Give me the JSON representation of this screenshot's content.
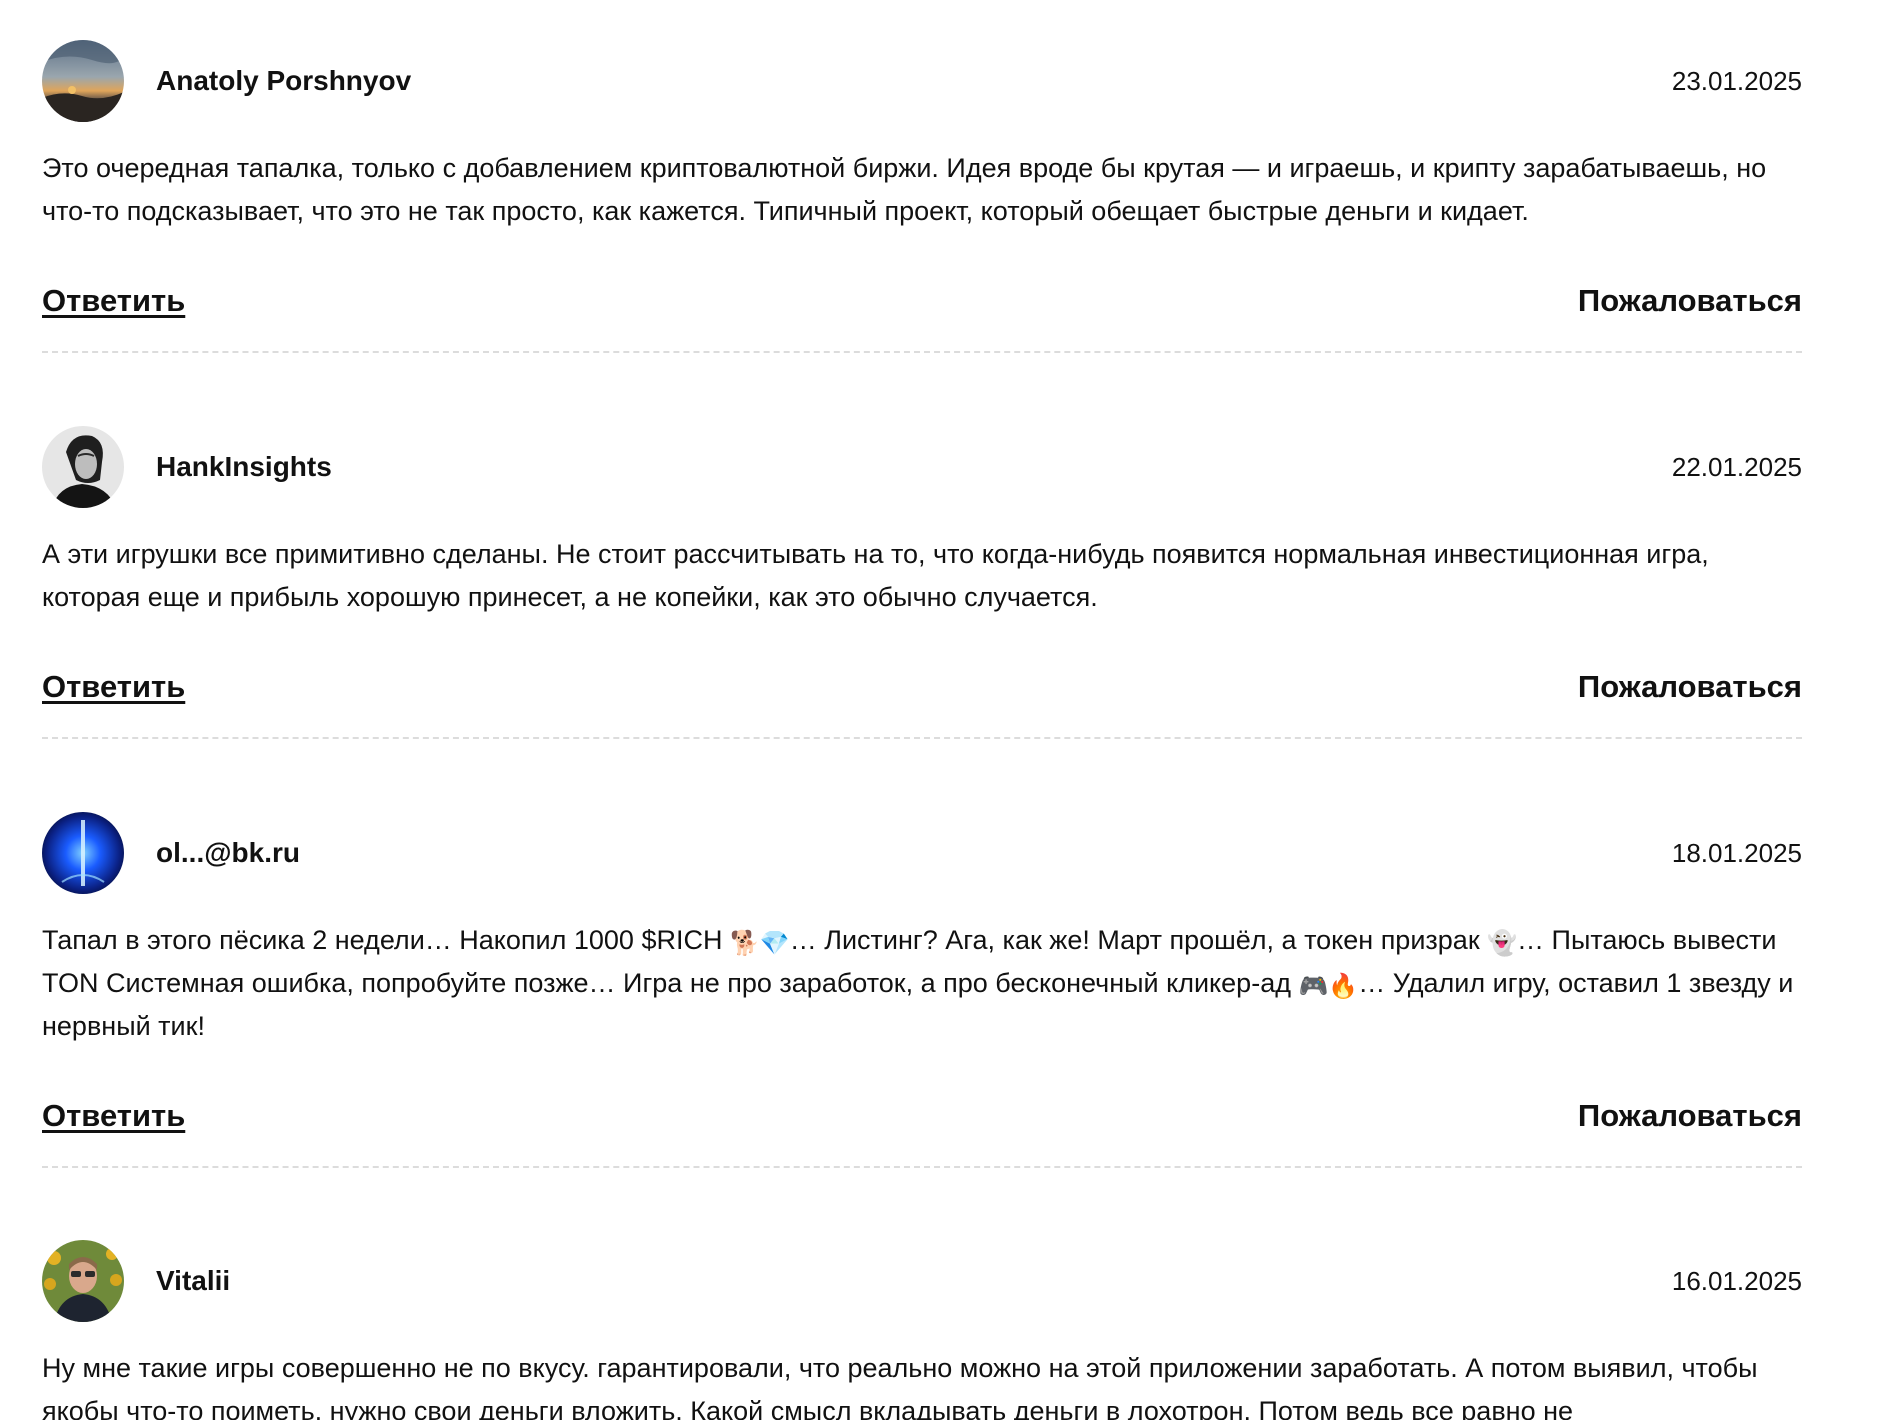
{
  "comments": [
    {
      "author": "Anatoly Porshnyov",
      "date": "23.01.2025",
      "avatar": "landscape-sunset",
      "text": "Это очередная тапалка, только с добавлением криптовалютной биржи. Идея вроде бы крутая — и играешь, и крипту зарабатываешь, но что-то подсказывает, что это не так просто, как кажется. Типичный проект, который обещает быстрые деньги и кидает.",
      "reply_label": "Ответить",
      "report_label": "Пожаловаться"
    },
    {
      "author": "HankInsights",
      "date": "22.01.2025",
      "avatar": "portrait-bw",
      "text": "А эти игрушки все примитивно сделаны. Не стоит рассчитывать на то, что когда-нибудь появится нормальная инвестиционная игра, которая еще и прибыль хорошую принесет, а не копейки, как это обычно случается.",
      "reply_label": "Ответить",
      "report_label": "Пожаловаться"
    },
    {
      "author": "ol...@bk.ru",
      "date": "18.01.2025",
      "avatar": "blue-light-beam",
      "text_parts": [
        "Тапал в этого пёсика 2 недели… Накопил 1000 $RICH ",
        "🐕💎",
        "… Листинг? Ага, как же! Март прошёл, а токен призрак ",
        "👻",
        "… Пытаюсь вывести TON Системная ошибка, попробуйте позже… Игра не про заработок, а про бесконечный кликер-ад ",
        "🎮🔥",
        "… Удалил игру, оставил 1 звезду и нервный тик!"
      ],
      "reply_label": "Ответить",
      "report_label": "Пожаловаться"
    },
    {
      "author": "Vitalii",
      "date": "16.01.2025",
      "avatar": "man-sunflowers",
      "text": "Ну мне такие игры совершенно не по вкусу. гарантировали, что реально можно на этой приложении заработать. А потом выявил, чтобы якобы что-то поиметь, нужно свои деньги вложить. Какой смысл вкладывать деньги в лохотрон. Потом ведь все равно не"
    }
  ]
}
